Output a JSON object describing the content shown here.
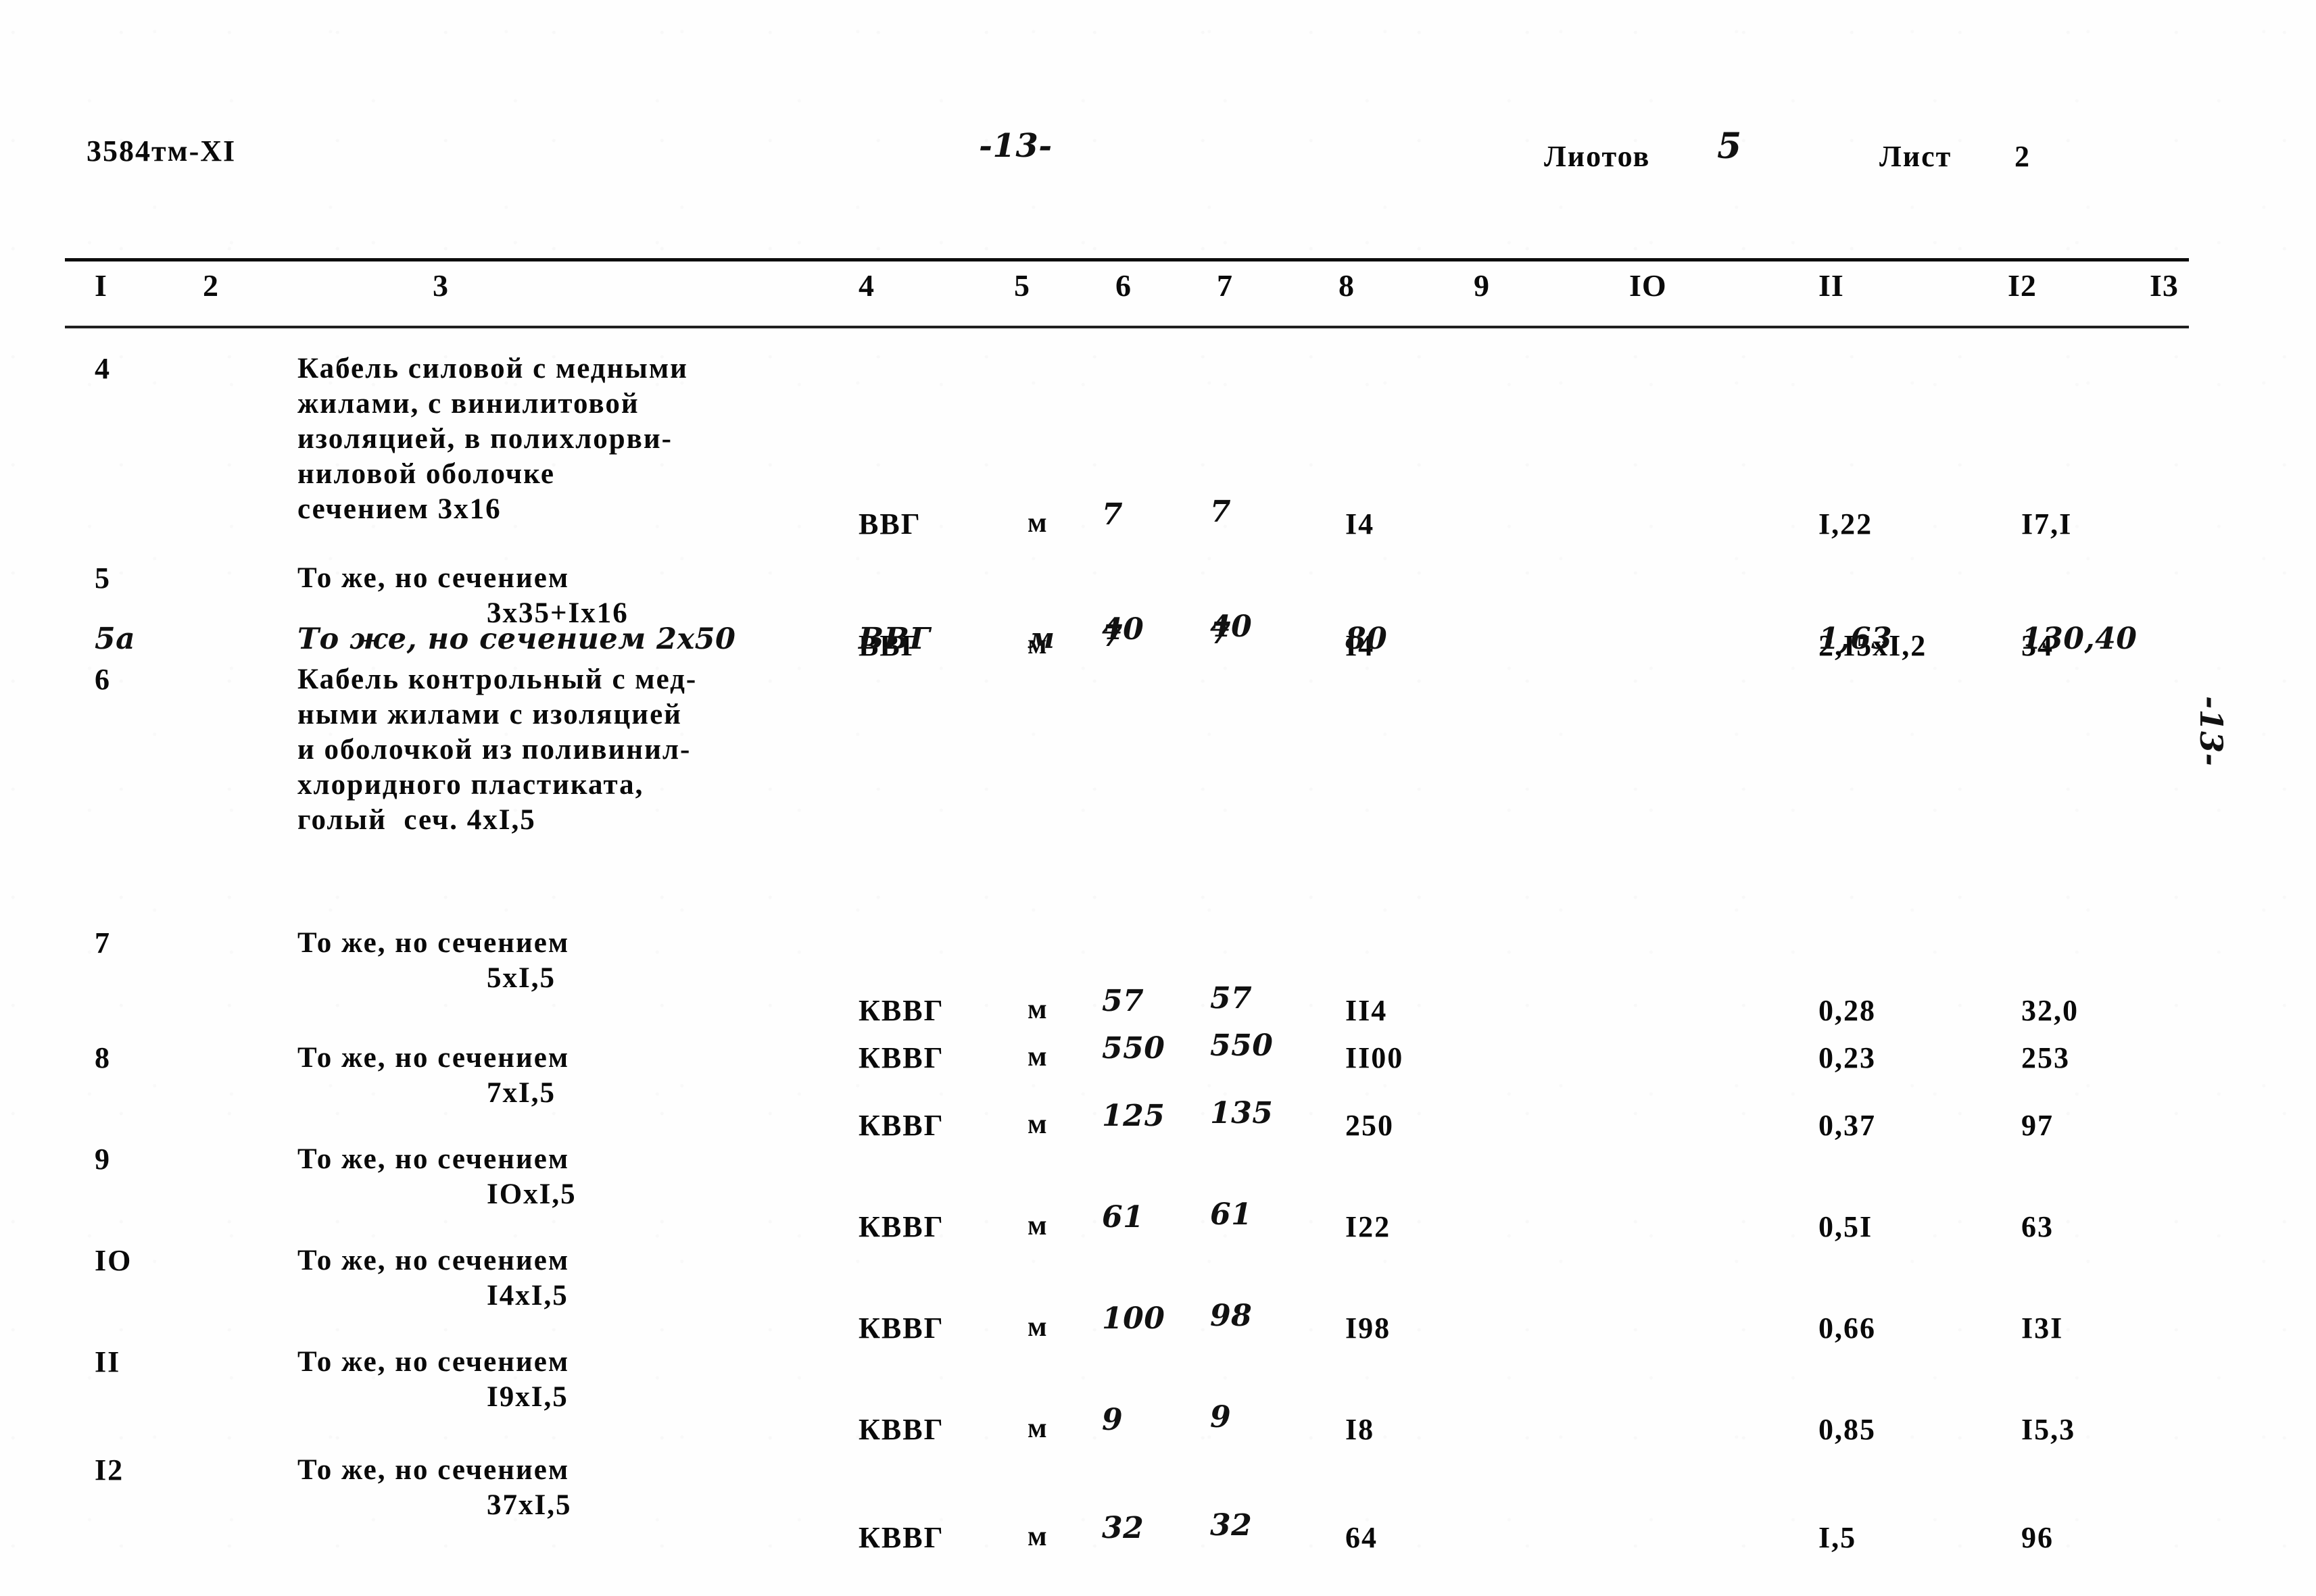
{
  "header": {
    "doc_code": "3584тм-ХI",
    "page_number": "-13-",
    "sheets_label": "Лиотов",
    "sheets_value": "5",
    "sheet_label": "Лист",
    "sheet_value": "2"
  },
  "margin_note": "-13-",
  "table": {
    "column_numbers": [
      "I",
      "2",
      "3",
      "4",
      "5",
      "6",
      "7",
      "8",
      "9",
      "IO",
      "II",
      "I2",
      "I3"
    ],
    "rows": [
      {
        "num": "4",
        "num_hand": false,
        "desc_lines": [
          "Кабель силовой с медными",
          "жилами, с винилитовой",
          "изоляцией, в полихлорви-",
          "ниловой оболочке",
          "сечением 3х16"
        ],
        "desc_indent_last": false,
        "mark": "ВВГ",
        "unit": "м",
        "qty1": "7",
        "qty2": "7",
        "total": "I4",
        "weight_unit": "I,22",
        "weight_total": "I7,I",
        "hand_qty": true,
        "hand_weights": false
      },
      {
        "num": "5",
        "num_hand": false,
        "desc_lines": [
          "То же, но сечением",
          "3х35+Iх16"
        ],
        "desc_indent_last": true,
        "mark": "ВВГ",
        "unit": "м",
        "qty1": "7",
        "qty2": "7",
        "total": "I4",
        "weight_unit": "2,I5хI,2",
        "weight_total": "34",
        "hand_qty": true,
        "hand_weights": false
      },
      {
        "num": "5а",
        "num_hand": true,
        "desc_lines": [
          "То же, но сечением 2х50"
        ],
        "desc_indent_last": false,
        "mark": "ВВГ",
        "unit": "м",
        "qty1": "40",
        "qty2": "40",
        "total": "80",
        "weight_unit": "1,63",
        "weight_total": "130,40",
        "hand_qty": true,
        "hand_weights": true,
        "hand_row": true
      },
      {
        "num": "6",
        "num_hand": false,
        "desc_lines": [
          "Кабель контрольный с мед-",
          "ными жилами с изоляцией",
          "и оболочкой из поливинил-",
          "хлоридного пластиката,",
          "голый  сеч. 4хI,5"
        ],
        "desc_indent_last": false,
        "mark": "КВВГ",
        "unit": "м",
        "qty1": "550",
        "qty2": "550",
        "total": "II00",
        "weight_unit": "0,23",
        "weight_total": "253",
        "hand_qty": true,
        "hand_weights": false
      },
      {
        "num": "7",
        "num_hand": false,
        "desc_lines": [
          "То же, но сечением",
          "5хI,5"
        ],
        "desc_indent_last": true,
        "mark": "КВВГ",
        "unit": "м",
        "qty1": "57",
        "qty2": "57",
        "total": "II4",
        "weight_unit": "0,28",
        "weight_total": "32,0",
        "hand_qty": true,
        "hand_weights": false
      },
      {
        "num": "8",
        "num_hand": false,
        "desc_lines": [
          "То же, но сечением",
          "7хI,5"
        ],
        "desc_indent_last": true,
        "mark": "КВВГ",
        "unit": "м",
        "qty1": "125",
        "qty2": "135",
        "total": "250",
        "weight_unit": "0,37",
        "weight_total": "97",
        "hand_qty": true,
        "hand_weights": false
      },
      {
        "num": "9",
        "num_hand": false,
        "desc_lines": [
          "То же, но сечением",
          "IOхI,5"
        ],
        "desc_indent_last": true,
        "mark": "КВВГ",
        "unit": "м",
        "qty1": "61",
        "qty2": "61",
        "total": "I22",
        "weight_unit": "0,5I",
        "weight_total": "63",
        "hand_qty": true,
        "hand_weights": false
      },
      {
        "num": "IO",
        "num_hand": false,
        "desc_lines": [
          "То же, но сечением",
          "I4хI,5"
        ],
        "desc_indent_last": true,
        "mark": "КВВГ",
        "unit": "м",
        "qty1": "100",
        "qty2": "98",
        "total": "I98",
        "weight_unit": "0,66",
        "weight_total": "I3I",
        "hand_qty": true,
        "hand_weights": false
      },
      {
        "num": "II",
        "num_hand": false,
        "desc_lines": [
          "То же, но сечением",
          "I9хI,5"
        ],
        "desc_indent_last": true,
        "mark": "КВВГ",
        "unit": "м",
        "qty1": "9",
        "qty2": "9",
        "total": "I8",
        "weight_unit": "0,85",
        "weight_total": "I5,3",
        "hand_qty": true,
        "hand_weights": false
      },
      {
        "num": "I2",
        "num_hand": false,
        "desc_lines": [
          "То же, но сечением",
          "37хI,5"
        ],
        "desc_indent_last": true,
        "mark": "КВВГ",
        "unit": "м",
        "qty1": "32",
        "qty2": "32",
        "total": "64",
        "weight_unit": "I,5",
        "weight_total": "96",
        "hand_qty": true,
        "hand_weights": false
      }
    ]
  },
  "layout": {
    "column_number_x": [
      140,
      300,
      640,
      1270,
      1500,
      1650,
      1800,
      1980,
      2180,
      2410,
      2690,
      2970,
      3180
    ],
    "row_tops": [
      20,
      330,
      420,
      480,
      870,
      1040,
      1190,
      1340,
      1490,
      1650
    ],
    "row_value_offsets": [
      230,
      100,
      0,
      560,
      100,
      100,
      100,
      100,
      100,
      100
    ]
  }
}
